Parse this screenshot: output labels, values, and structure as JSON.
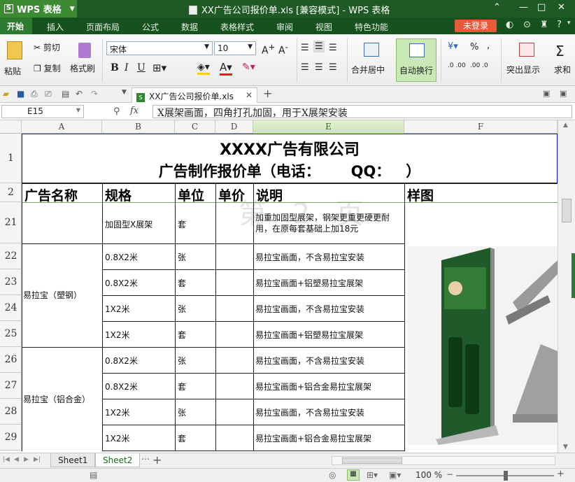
{
  "app": {
    "name": "WPS 表格",
    "window_title": "XX广告公司报价单.xls [兼容模式] - WPS 表格"
  },
  "menu": {
    "items": [
      "开始",
      "插入",
      "页面布局",
      "公式",
      "数据",
      "表格样式",
      "审阅",
      "视图",
      "特色功能"
    ],
    "login": "未登录"
  },
  "ribbon": {
    "paste": "粘贴",
    "cut": "剪切",
    "copy": "复制",
    "format_painter": "格式刷",
    "font_name": "宋体",
    "font_size": "10",
    "bold": "B",
    "italic": "I",
    "underline": "U",
    "merge_center": "合并居中",
    "wrap_text": "自动换行",
    "percent": "%",
    "highlight": "突出显示",
    "sort_partial": "求和"
  },
  "doc_tab": {
    "name": "XX广告公司报价单.xls"
  },
  "formula_bar": {
    "cell_ref": "E15",
    "fx": "fx",
    "content": "X展架画面，四角打孔加固，用于X展架安装"
  },
  "columns": [
    "A",
    "B",
    "C",
    "D",
    "E",
    "F"
  ],
  "rows": [
    "1",
    "2",
    "21",
    "22",
    "23",
    "24",
    "25",
    "26",
    "27",
    "28",
    "29"
  ],
  "sheet": {
    "title1": "XXXX广告有限公司",
    "title2": "广告制作报价单（电话：      QQ：   ）",
    "headers": [
      "广告名称",
      "规格",
      "单位",
      "单价",
      "说明",
      "样图"
    ],
    "row21": {
      "spec": "加固型X展架",
      "unit": "套",
      "desc": "加重加固型展架，钢架更重更硬更耐用，在原每套基础上加18元"
    },
    "group1": "易拉宝（塑钢）",
    "group2": "易拉宝（铝合金）",
    "data": [
      {
        "spec": "0.8X2米",
        "unit": "张",
        "desc": "易拉宝画面，不含易拉宝安装"
      },
      {
        "spec": "0.8X2米",
        "unit": "套",
        "desc": "易拉宝画面+铝塑易拉宝展架"
      },
      {
        "spec": "1X2米",
        "unit": "张",
        "desc": "易拉宝画面，不含易拉宝安装"
      },
      {
        "spec": "1X2米",
        "unit": "套",
        "desc": "易拉宝画面+铝塑易拉宝展架"
      },
      {
        "spec": "0.8X2米",
        "unit": "张",
        "desc": "易拉宝画面，不含易拉宝安装"
      },
      {
        "spec": "0.8X2米",
        "unit": "套",
        "desc": "易拉宝画面+铝合金易拉宝展架"
      },
      {
        "spec": "1X2米",
        "unit": "张",
        "desc": "易拉宝画面，不含易拉宝安装"
      },
      {
        "spec": "1X2米",
        "unit": "套",
        "desc": "易拉宝画面+铝合金易拉宝展架"
      }
    ],
    "watermark": "第 2 页"
  },
  "sheets": [
    "Sheet1",
    "Sheet2"
  ],
  "zoom": "100 %",
  "colors": {
    "brand_green": "#2d7b30",
    "title_green": "#1f5a24",
    "login_red": "#e55a38"
  }
}
